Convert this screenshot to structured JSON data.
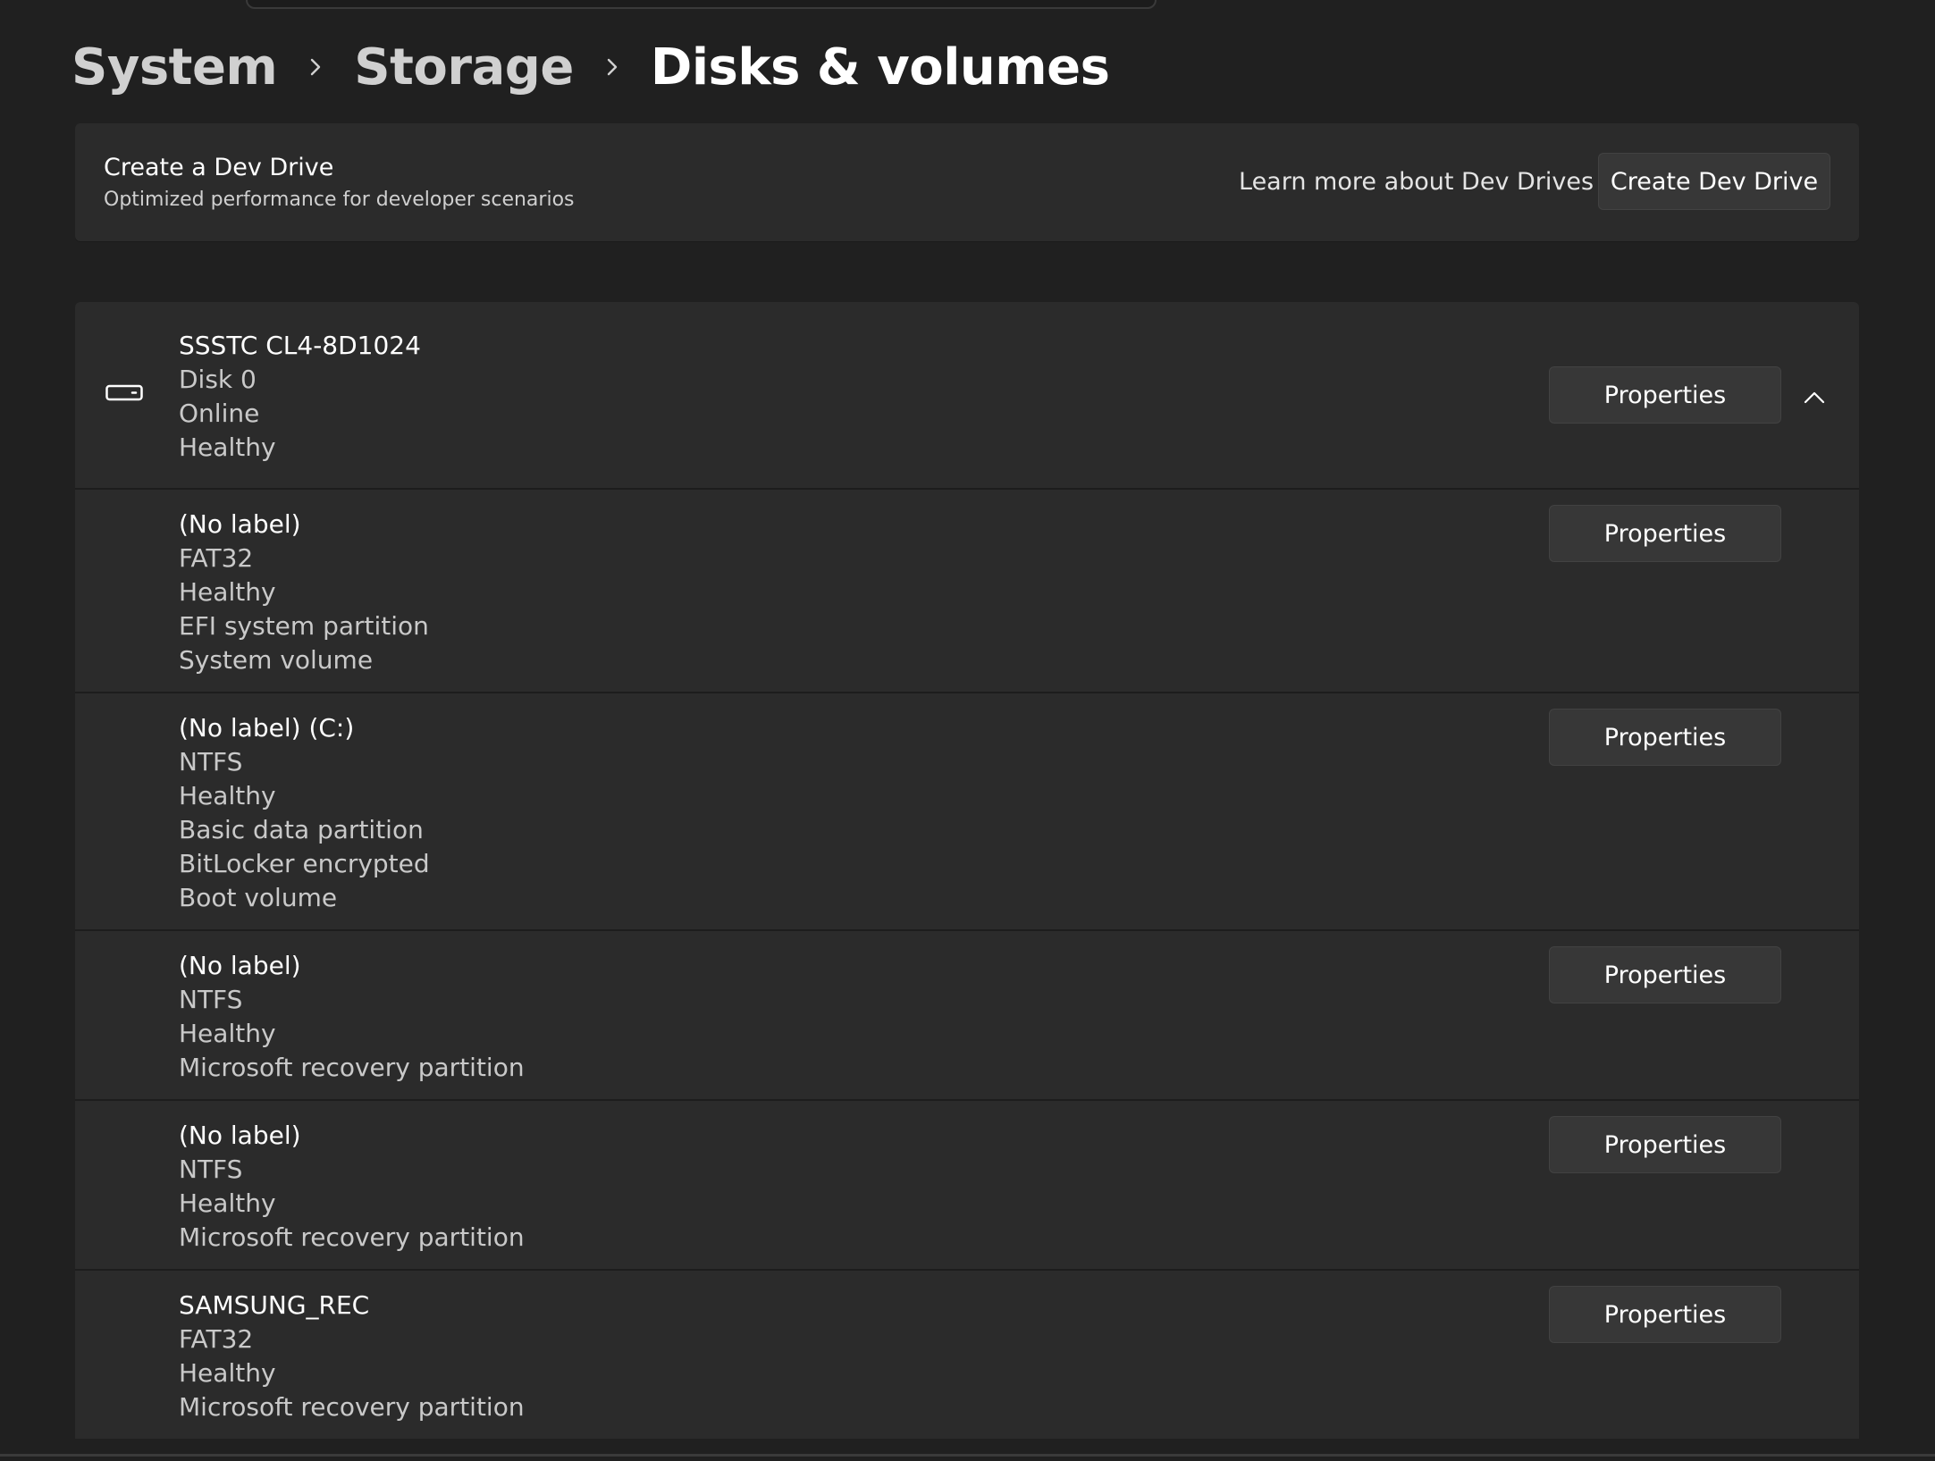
{
  "breadcrumb": {
    "items": [
      "System",
      "Storage",
      "Disks & volumes"
    ]
  },
  "dev_drive": {
    "title": "Create a Dev Drive",
    "subtitle": "Optimized performance for developer scenarios",
    "learn_more": "Learn more about Dev Drives",
    "create_button": "Create Dev Drive"
  },
  "disk": {
    "icon": "drive-icon",
    "lines": [
      "SSSTC CL4-8D1024",
      "Disk 0",
      "Online",
      "Healthy"
    ],
    "properties_label": "Properties",
    "collapse_icon": "chevron-up-icon"
  },
  "volumes": [
    {
      "lines": [
        "(No label)",
        "FAT32",
        "Healthy",
        "EFI system partition",
        "System volume"
      ],
      "properties_label": "Properties"
    },
    {
      "lines": [
        "(No label) (C:)",
        "NTFS",
        "Healthy",
        "Basic data partition",
        "BitLocker encrypted",
        "Boot volume"
      ],
      "properties_label": "Properties"
    },
    {
      "lines": [
        "(No label)",
        "NTFS",
        "Healthy",
        "Microsoft recovery partition"
      ],
      "properties_label": "Properties"
    },
    {
      "lines": [
        "(No label)",
        "NTFS",
        "Healthy",
        "Microsoft recovery partition"
      ],
      "properties_label": "Properties"
    },
    {
      "lines": [
        "SAMSUNG_REC",
        "FAT32",
        "Healthy",
        "Microsoft recovery partition"
      ],
      "properties_label": "Properties"
    }
  ],
  "colors": {
    "background": "#202020",
    "card": "#2b2b2b",
    "button": "#373737",
    "text_primary": "#ffffff",
    "text_secondary": "#c9c9c9"
  }
}
